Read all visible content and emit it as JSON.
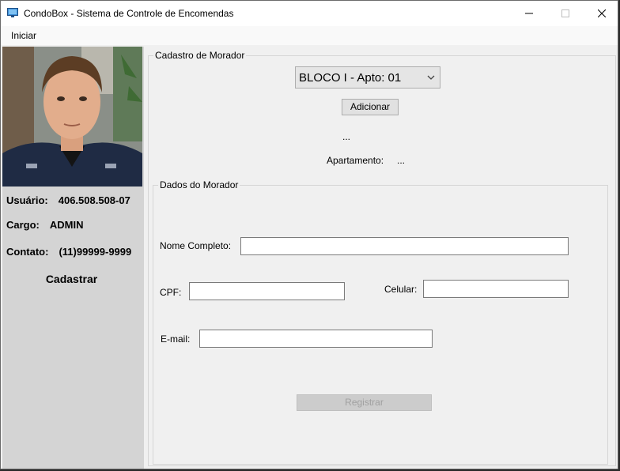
{
  "window": {
    "title": "CondoBox - Sistema de Controle de Encomendas"
  },
  "menu": {
    "items": [
      "Iniciar"
    ]
  },
  "sidebar": {
    "user_label": "Usuário:",
    "user_value": "406.508.508-07",
    "cargo_label": "Cargo:",
    "cargo_value": "ADMIN",
    "contato_label": "Contato:",
    "contato_value": "(11)99999-9999",
    "cadastrar_label": "Cadastrar"
  },
  "cadastro": {
    "legend": "Cadastro de Morador",
    "select_value": "BLOCO I - Apto: 01",
    "add_button": "Adicionar",
    "status_text": "...",
    "apartamento_label": "Apartamento:",
    "apartamento_value": "..."
  },
  "dados": {
    "legend": "Dados do Morador",
    "nome_label": "Nome Completo:",
    "nome_value": "",
    "cpf_label": "CPF:",
    "cpf_value": "",
    "celular_label": "Celular:",
    "celular_value": "",
    "email_label": "E-mail:",
    "email_value": "",
    "register_button": "Registrar"
  }
}
